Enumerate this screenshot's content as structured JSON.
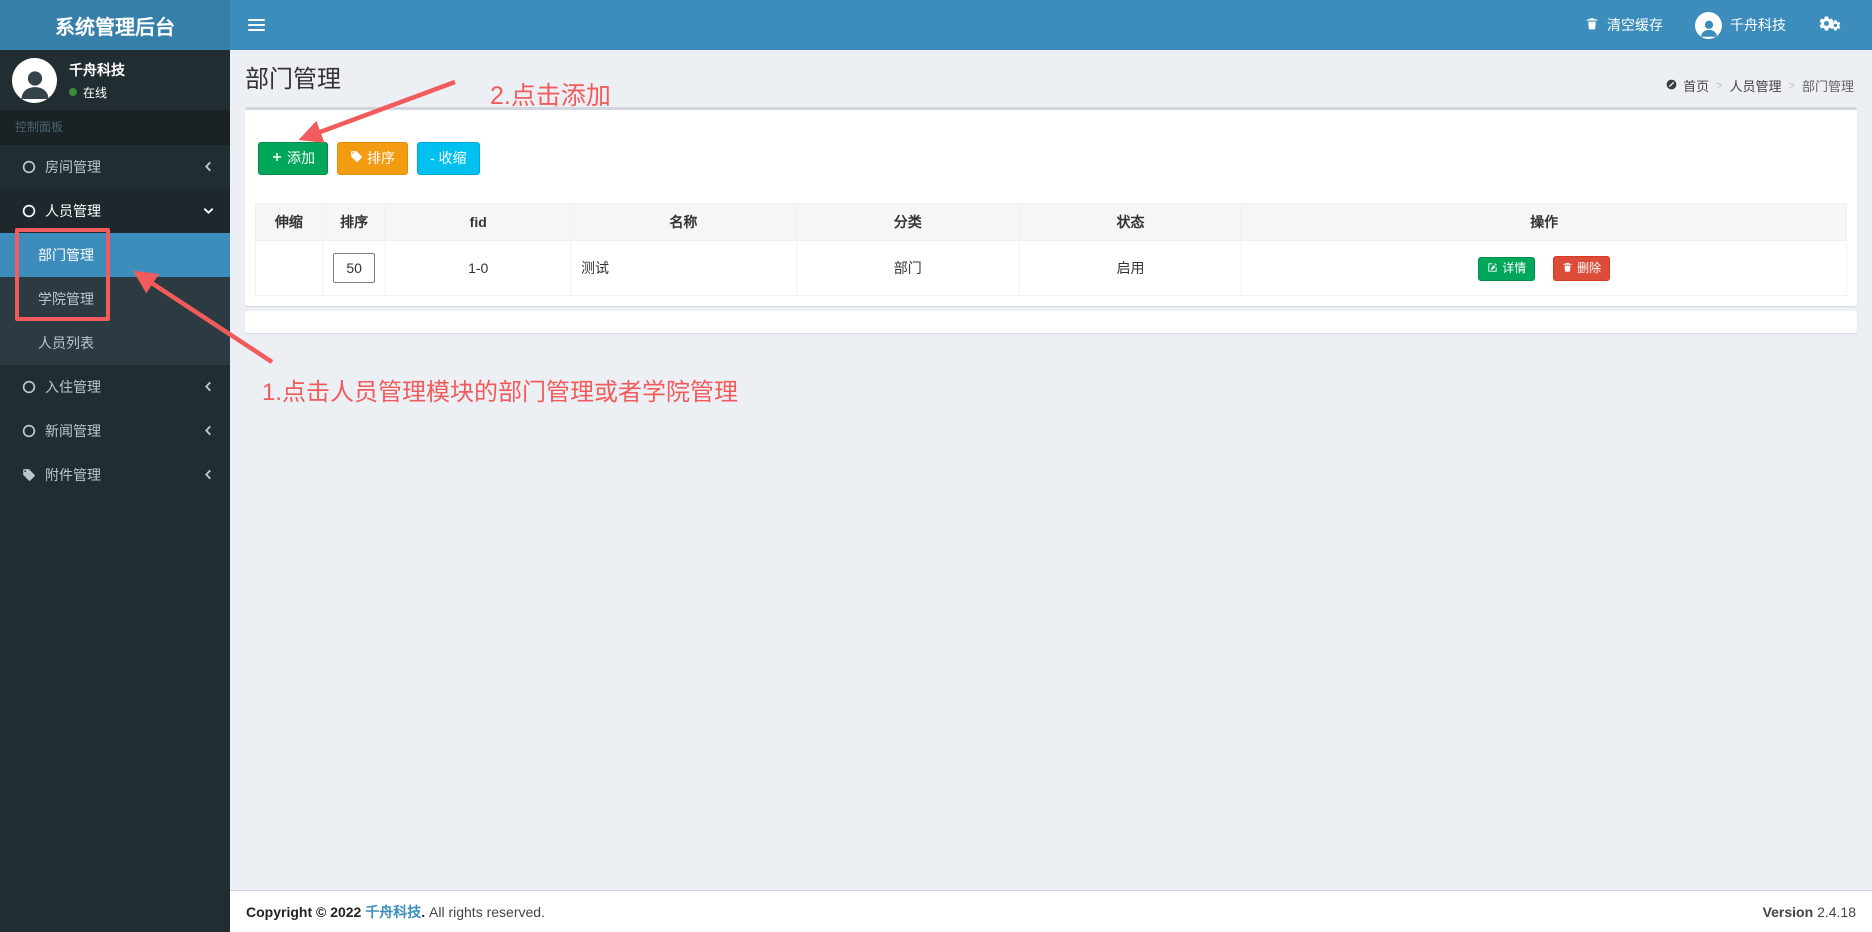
{
  "navbar": {
    "brand": "系统管理后台",
    "clear_cache": "清空缓存",
    "user_name": "千舟科技"
  },
  "sidebar": {
    "user": {
      "name": "千舟科技",
      "status": "在线"
    },
    "section_header": "控制面板",
    "items": [
      "房间管理",
      "人员管理",
      "部门管理",
      "学院管理",
      "人员列表",
      "入住管理",
      "新闻管理",
      "附件管理"
    ]
  },
  "page": {
    "title": "部门管理",
    "breadcrumb": [
      "首页",
      "人员管理",
      "部门管理"
    ],
    "breadcrumb_sep": ">"
  },
  "toolbar": {
    "add": "添加",
    "sort": "排序",
    "collapse": "- 收缩"
  },
  "table": {
    "headers": [
      "伸缩",
      "排序",
      "fid",
      "名称",
      "分类",
      "状态",
      "操作"
    ],
    "row": {
      "expand": "",
      "sort_value": "50",
      "fid": "1-0",
      "name": "测试",
      "category": "部门",
      "status": "启用",
      "detail_label": "详情",
      "delete_label": "删除"
    }
  },
  "annotations": {
    "step1": "1.点击人员管理模块的部门管理或者学院管理",
    "step2": "2.点击添加"
  },
  "footer": {
    "copyright_prefix": "Copyright © 2022",
    "company": "千舟科技",
    "period": ".",
    "copyright_suffix": "All rights reserved.",
    "version_label": "Version",
    "version": "2.4.18"
  },
  "colors": {
    "navbar": "#3c8dbc",
    "logo_bg": "#367fa9",
    "sidebar_bg": "#222d32",
    "active_item": "#3c8dbc",
    "btn_green": "#00a65a",
    "btn_orange": "#f39c12",
    "btn_cyan": "#00c0ef",
    "btn_red": "#dd4b39",
    "annotation_red": "#f15b5b",
    "content_bg": "#ecf0f5"
  }
}
